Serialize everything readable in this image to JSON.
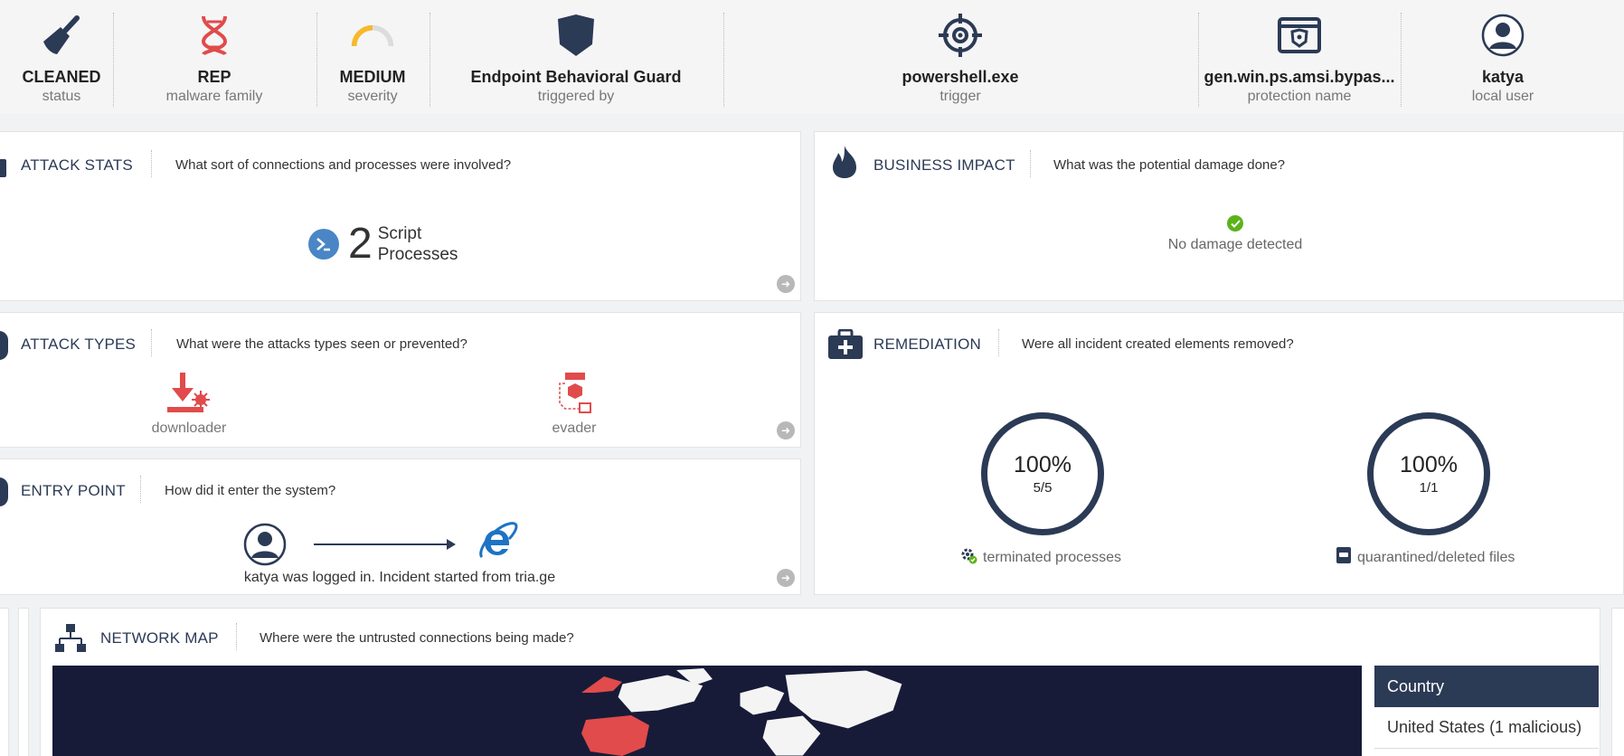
{
  "summary": [
    {
      "value": "CLEANED",
      "label": "status",
      "icon": "broom-icon"
    },
    {
      "value": "REP",
      "label": "malware family",
      "icon": "dna-icon"
    },
    {
      "value": "MEDIUM",
      "label": "severity",
      "icon": "gauge-icon",
      "severity_level": 0.5
    },
    {
      "value": "Endpoint Behavioral Guard",
      "label": "triggered by",
      "icon": "shield-icon"
    },
    {
      "value": "powershell.exe",
      "label": "trigger",
      "icon": "crosshair-icon"
    },
    {
      "value": "gen.win.ps.amsi.bypas...",
      "label": "protection name",
      "icon": "window-shield-icon"
    },
    {
      "value": "katya",
      "label": "local user",
      "icon": "user-icon"
    }
  ],
  "attack_stats": {
    "title": "ATTACK STATS",
    "question": "What sort of connections and processes were involved?",
    "count": "2",
    "count_label_1": "Script",
    "count_label_2": "Processes"
  },
  "business_impact": {
    "title": "BUSINESS IMPACT",
    "question": "What was the potential damage done?",
    "status": "No damage detected"
  },
  "attack_types": {
    "title": "ATTACK TYPES",
    "question": "What were the attacks types seen or prevented?",
    "items": [
      {
        "label": "downloader",
        "icon": "downloader-icon"
      },
      {
        "label": "evader",
        "icon": "evader-icon"
      }
    ]
  },
  "remediation": {
    "title": "REMEDIATION",
    "question": "Were all incident created elements removed?",
    "items": [
      {
        "percent": "100%",
        "fraction": "5/5",
        "label": "terminated processes",
        "icon": "gear-check-icon"
      },
      {
        "percent": "100%",
        "fraction": "1/1",
        "label": "quarantined/deleted files",
        "icon": "quarantine-icon"
      }
    ]
  },
  "entry_point": {
    "title": "ENTRY POINT",
    "question": "How did it enter the system?",
    "description": "katya was logged in. Incident started from tria.ge"
  },
  "network_map": {
    "title": "NETWORK MAP",
    "question": "Where were the untrusted connections being made?",
    "table_header": "Country",
    "rows": [
      "United States (1 malicious)"
    ]
  },
  "colors": {
    "navy": "#2b3a55",
    "red": "#e14b4b",
    "blue": "#4a86c5",
    "green": "#5bb318",
    "gauge": "#f6b92b",
    "map_bg": "#171b38"
  }
}
